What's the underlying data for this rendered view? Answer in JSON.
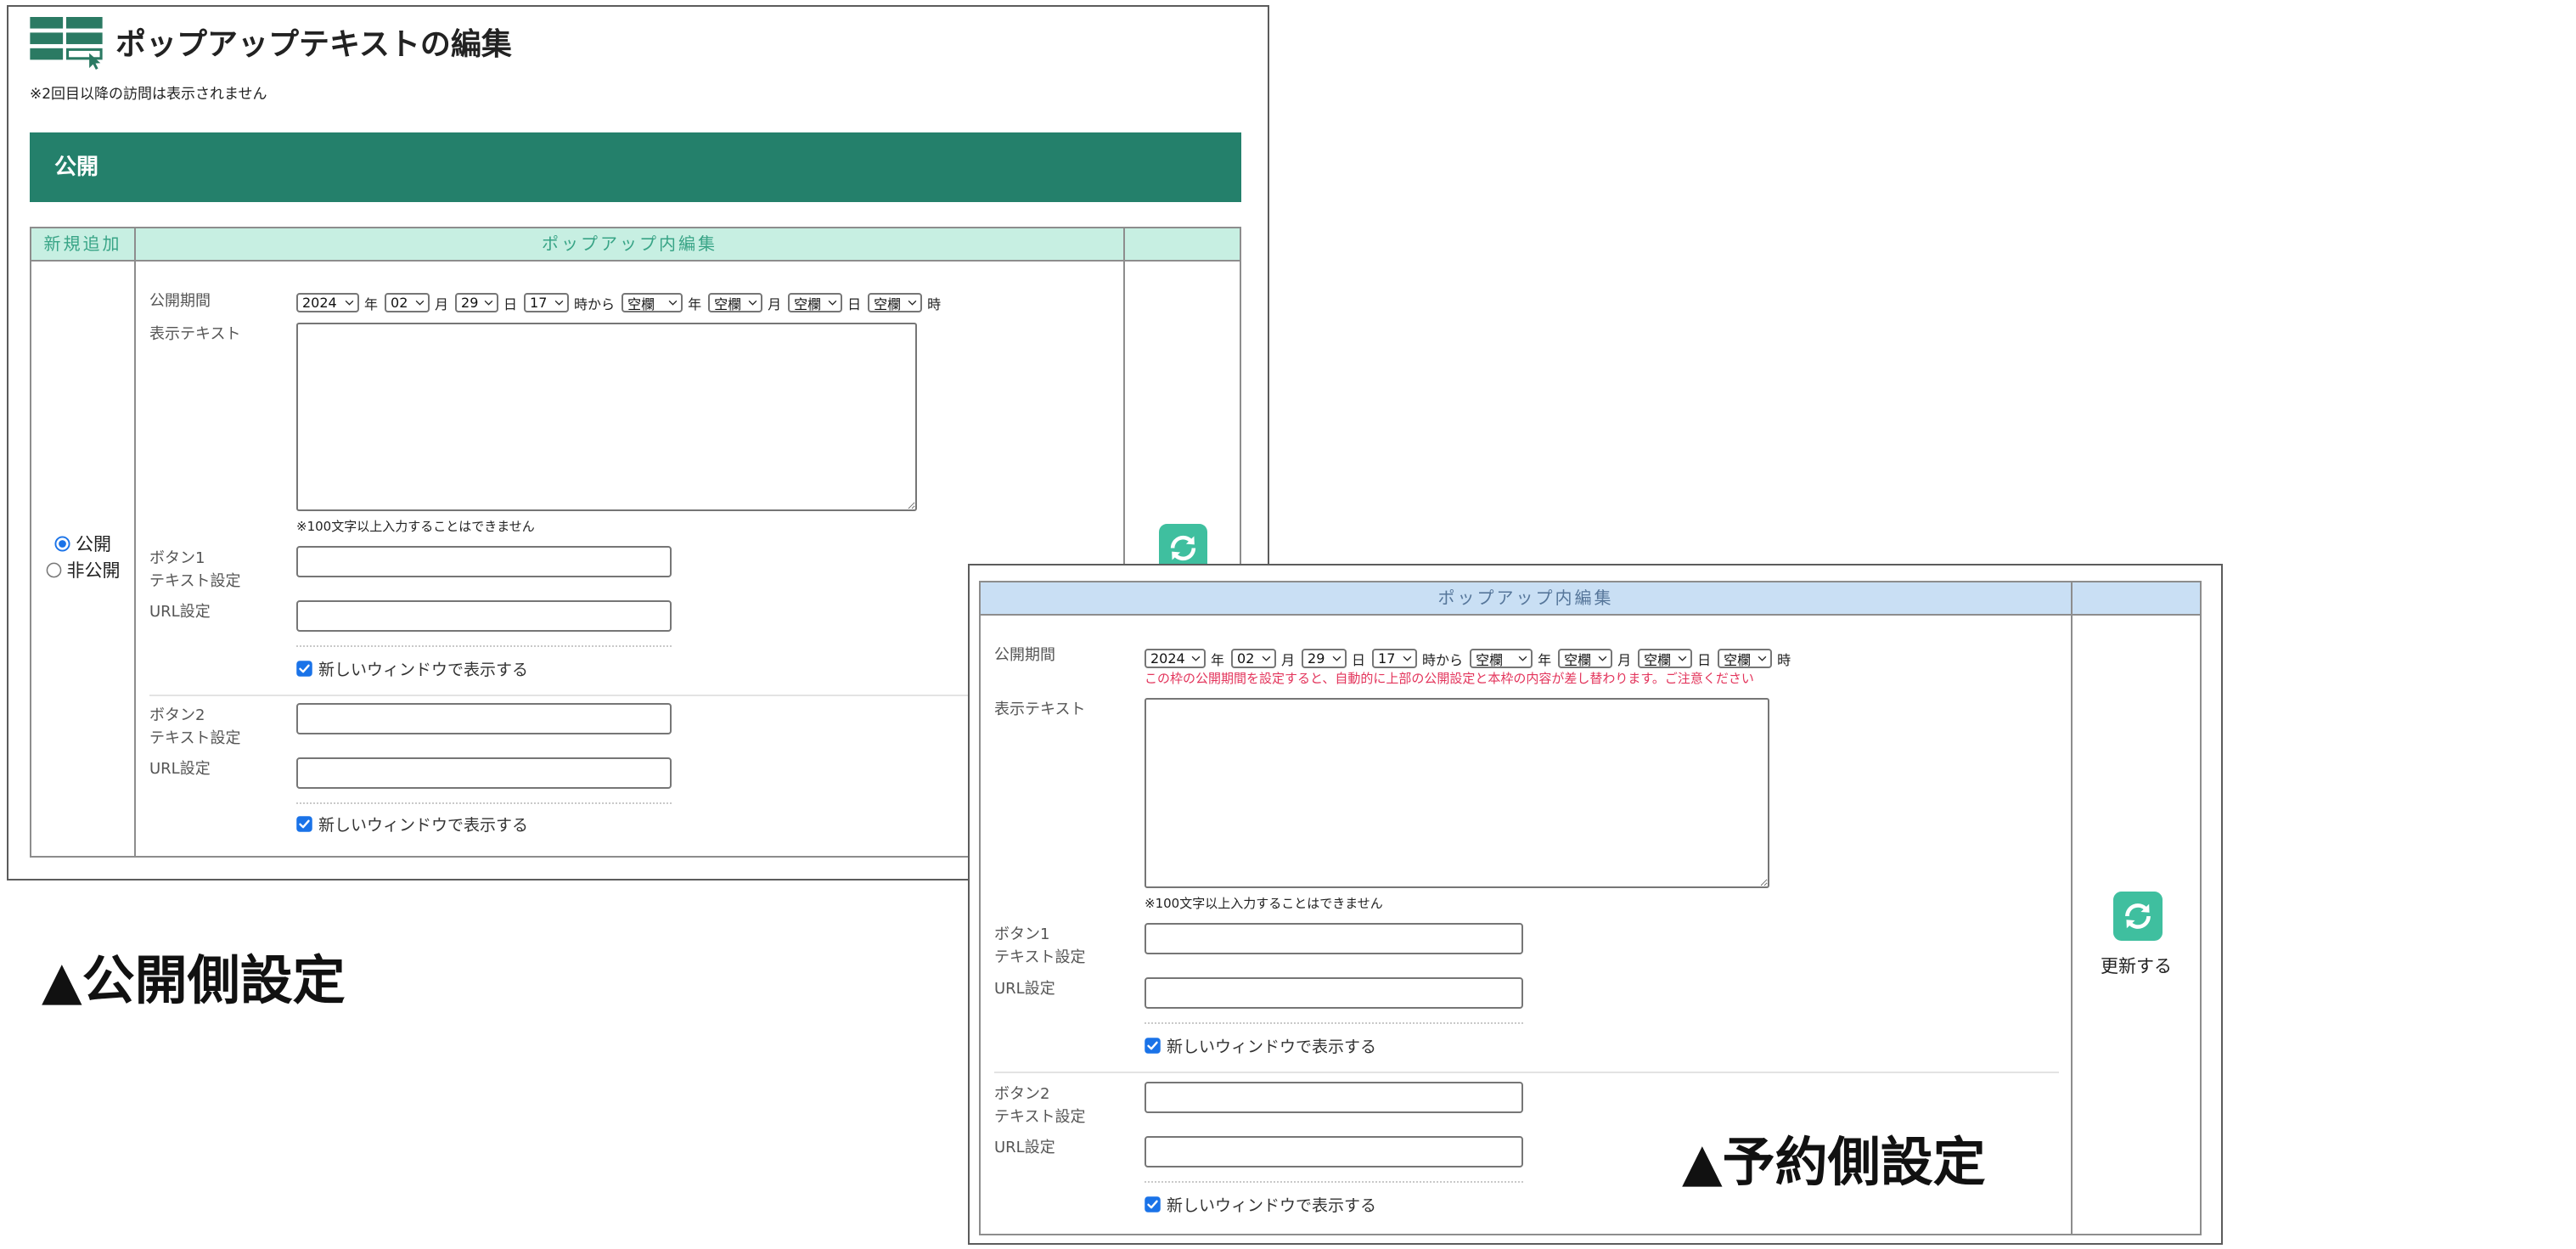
{
  "header": {
    "icon": "table-edit-icon",
    "title": "ポップアップテキストの編集",
    "note": "※2回目以降の訪問は表示されません"
  },
  "public_panel": {
    "section_title": "公開",
    "columns": {
      "add_new": "新規追加",
      "editor": "ポップアップ内編集"
    },
    "visibility": {
      "options": [
        {
          "label": "公開",
          "checked": true
        },
        {
          "label": "非公開",
          "checked": false
        }
      ]
    },
    "period": {
      "label": "公開期間",
      "start": {
        "year": "2024",
        "month": "02",
        "day": "29",
        "hour": "17"
      },
      "end": {
        "year": "空欄",
        "month": "空欄",
        "day": "空欄",
        "hour": "空欄"
      },
      "units": {
        "year": "年",
        "month": "月",
        "day": "日",
        "from": "時から",
        "hour": "時"
      }
    },
    "display_text": {
      "label": "表示テキスト",
      "value": "",
      "note": "※100文字以上入力することはできません"
    },
    "button1": {
      "label": "ボタン1",
      "text_label": "テキスト設定",
      "text_value": "",
      "url_label": "URL設定",
      "url_value": "",
      "new_window_label": "新しいウィンドウで表示する",
      "new_window": true
    },
    "button2": {
      "label": "ボタン2",
      "text_label": "テキスト設定",
      "text_value": "",
      "url_label": "URL設定",
      "url_value": "",
      "new_window_label": "新しいウィンドウで表示する",
      "new_window": true
    },
    "update_icon": "refresh-icon"
  },
  "reserved_panel": {
    "columns": {
      "editor": "ポップアップ内編集"
    },
    "period": {
      "label": "公開期間",
      "start": {
        "year": "2024",
        "month": "02",
        "day": "29",
        "hour": "17"
      },
      "end": {
        "year": "空欄",
        "month": "空欄",
        "day": "空欄",
        "hour": "空欄"
      },
      "units": {
        "year": "年",
        "month": "月",
        "day": "日",
        "from": "時から",
        "hour": "時"
      },
      "warning": "この枠の公開期間を設定すると、自動的に上部の公開設定と本枠の内容が差し替わります。ご注意ください"
    },
    "display_text": {
      "label": "表示テキスト",
      "value": "",
      "note": "※100文字以上入力することはできません"
    },
    "button1": {
      "label": "ボタン1",
      "text_label": "テキスト設定",
      "text_value": "",
      "url_label": "URL設定",
      "url_value": "",
      "new_window_label": "新しいウィンドウで表示する",
      "new_window": true
    },
    "button2": {
      "label": "ボタン2",
      "text_label": "テキスト設定",
      "text_value": "",
      "url_label": "URL設定",
      "url_value": "",
      "new_window_label": "新しいウィンドウで表示する",
      "new_window": true
    },
    "update_button": {
      "icon": "refresh-icon",
      "label": "更新する"
    }
  },
  "annotations": {
    "public": "▲公開側設定",
    "reserved": "▲予約側設定"
  },
  "colors": {
    "brand_green": "#24806b",
    "mint_header": "#c7efe2",
    "blue_header": "#c9dff4",
    "refresh_button": "#3fbf9f",
    "warning_text": "#e3345b",
    "checkbox_blue": "#1a73e8"
  }
}
